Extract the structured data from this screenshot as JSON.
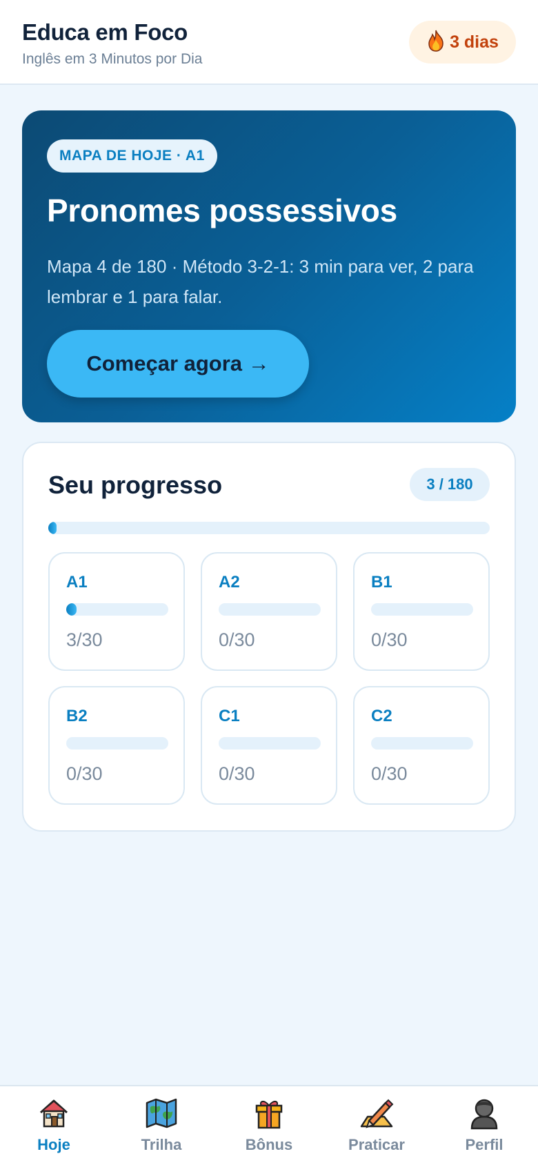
{
  "header": {
    "title": "Educa em Foco",
    "subtitle": "Inglês em 3 Minutos por Dia",
    "streak_label": "3 dias",
    "streak_icon": "fire-icon"
  },
  "hero": {
    "pill": "MAPA DE HOJE · A1",
    "title": "Pronomes possessivos",
    "description": "Mapa 4 de 180 · Método 3-2-1: 3 min para ver, 2 para lembrar e 1 para falar.",
    "cta_label": "Começar agora →"
  },
  "progress": {
    "title": "Seu progresso",
    "badge": "3 / 180",
    "fraction": 0.0167,
    "levels": [
      {
        "name": "A1",
        "count": "3/30",
        "fraction": 0.1
      },
      {
        "name": "A2",
        "count": "0/30",
        "fraction": 0
      },
      {
        "name": "B1",
        "count": "0/30",
        "fraction": 0
      },
      {
        "name": "B2",
        "count": "0/30",
        "fraction": 0
      },
      {
        "name": "C1",
        "count": "0/30",
        "fraction": 0
      },
      {
        "name": "C2",
        "count": "0/30",
        "fraction": 0
      }
    ]
  },
  "nav": {
    "active": "Hoje",
    "items": [
      {
        "label": "Hoje",
        "icon": "house-icon"
      },
      {
        "label": "Trilha",
        "icon": "map-icon"
      },
      {
        "label": "Bônus",
        "icon": "gift-icon"
      },
      {
        "label": "Praticar",
        "icon": "pencil-icon"
      },
      {
        "label": "Perfil",
        "icon": "person-icon"
      }
    ]
  },
  "colors": {
    "accent": "#0a7fc1",
    "cta": "#3bb8f5",
    "streak": "#c2410c",
    "hero_start": "#0c4a74",
    "hero_end": "#0580c7"
  }
}
